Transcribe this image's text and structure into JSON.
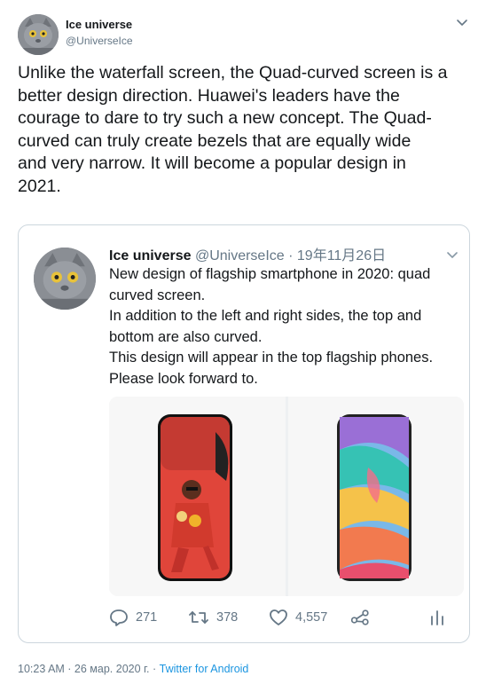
{
  "author": {
    "name": "Ice universe",
    "handle": "@UniverseIce"
  },
  "tweet": {
    "text": "Unlike the waterfall screen, the Quad-curved screen is a\nbetter design direction. Huawei's leaders have the\ncourage to dare to try such a new concept. The Quad-\ncurved  can truly create bezels that are equally wide\nand very narrow. It will become a popular design in\n2021."
  },
  "quoted": {
    "name": "Ice universe",
    "handle": "@UniverseIce",
    "separator": " · ",
    "date": "19年11月26日",
    "text": "New design of flagship smartphone in 2020: quad\ncurved screen.\nIn addition to the left and right sides, the top and\nbottom are also curved.\nThis design will appear in the top flagship phones.\nPlease look forward to.",
    "actions": {
      "replies": "271",
      "retweets": "378",
      "likes": "4,557"
    }
  },
  "footer": {
    "timestamp": "10:23 AM · 26 мар. 2020 г. · ",
    "source": "Twitter for Android"
  },
  "icons": {
    "caret": "chevron-down-icon",
    "reply": "reply-icon",
    "retweet": "retweet-icon",
    "like": "heart-icon",
    "share": "share-icon",
    "stats": "stats-icon"
  },
  "colors": {
    "text": "#14171a",
    "secondary": "#657786",
    "link": "#1b95e0",
    "border": "#ccd6dd"
  }
}
